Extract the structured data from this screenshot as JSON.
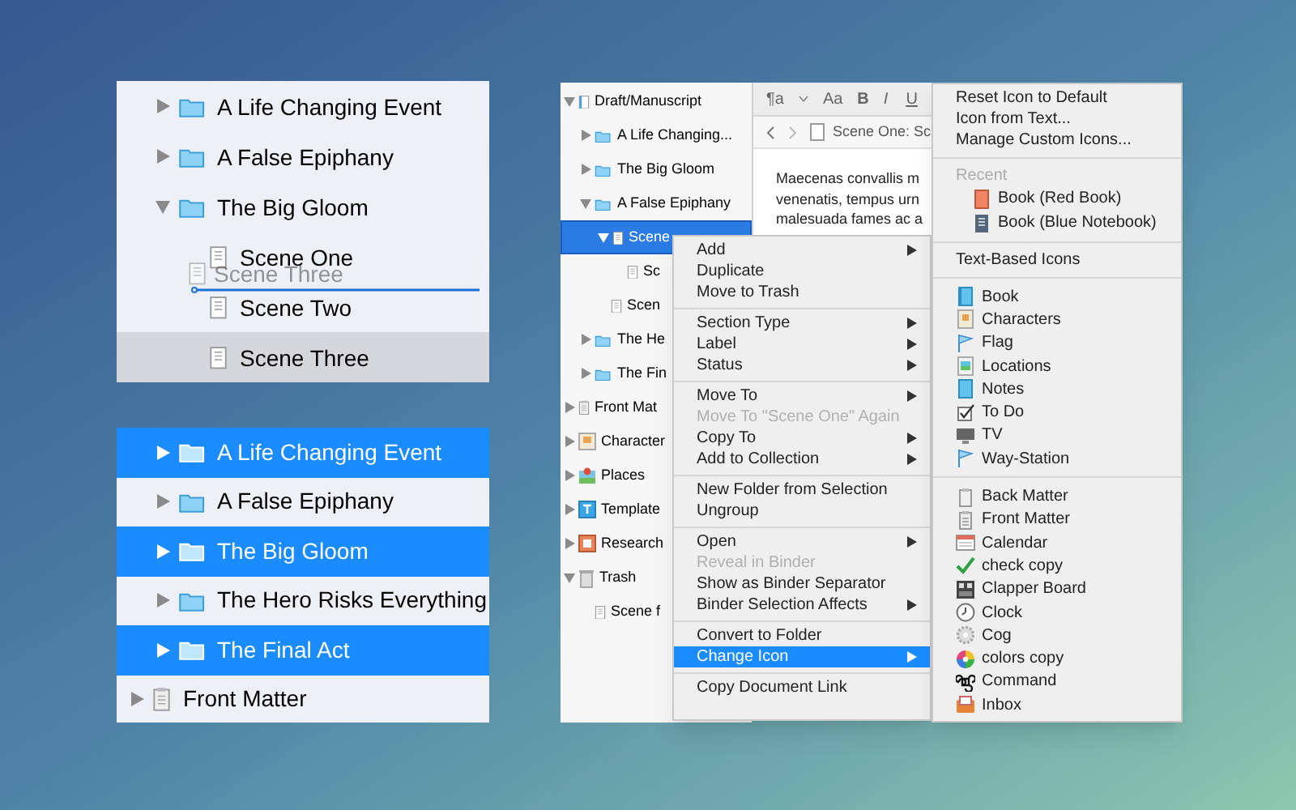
{
  "outline_panel": {
    "items": [
      {
        "label": "A Life Changing Event",
        "kind": "folder",
        "expanded": false,
        "selected": false
      },
      {
        "label": "A False Epiphany",
        "kind": "folder",
        "expanded": false,
        "selected": false
      },
      {
        "label": "The Big Gloom",
        "kind": "folder",
        "expanded": true,
        "selected": false,
        "children": [
          {
            "label": "Scene One",
            "kind": "document",
            "selected": false
          },
          {
            "label": "Scene Two",
            "kind": "document",
            "selected": false
          },
          {
            "label": "Scene Three",
            "kind": "document",
            "selected": true
          }
        ]
      }
    ],
    "drag_ghost": {
      "label": "Scene Three"
    }
  },
  "selection_panel": {
    "items": [
      {
        "label": "A Life Changing Event",
        "kind": "folder",
        "selected": true
      },
      {
        "label": "A False Epiphany",
        "kind": "folder",
        "selected": false
      },
      {
        "label": "The Big Gloom",
        "kind": "folder",
        "selected": true
      },
      {
        "label": "The Hero Risks Everything",
        "kind": "folder",
        "selected": false
      },
      {
        "label": "The Final Act",
        "kind": "folder",
        "selected": true
      },
      {
        "label": "Front Matter",
        "kind": "front-matter",
        "selected": false
      }
    ]
  },
  "binder": {
    "items": [
      {
        "label": "Draft/Manuscript",
        "kind": "draft",
        "expanded": true,
        "selected": false,
        "children": [
          {
            "label": "A Life Changing...",
            "kind": "folder",
            "expanded": false,
            "selected": false
          },
          {
            "label": "The Big Gloom",
            "kind": "folder",
            "expanded": false,
            "selected": false
          },
          {
            "label": "A False Epiphany",
            "kind": "folder",
            "expanded": true,
            "selected": false,
            "children": [
              {
                "label": "Scene",
                "kind": "document",
                "expanded": true,
                "selected": true,
                "children": [
                  {
                    "label": "Sc",
                    "kind": "document",
                    "selected": false
                  }
                ]
              },
              {
                "label": "Scen",
                "kind": "document",
                "selected": false
              }
            ]
          },
          {
            "label": "The He",
            "kind": "folder",
            "expanded": false,
            "selected": false
          },
          {
            "label": "The Fin",
            "kind": "folder",
            "expanded": false,
            "selected": false
          }
        ]
      },
      {
        "label": "Front Mat",
        "kind": "front-matter",
        "expanded": false,
        "selected": false
      },
      {
        "label": "Character",
        "kind": "characters",
        "expanded": false,
        "selected": false
      },
      {
        "label": "Places",
        "kind": "places",
        "expanded": false,
        "selected": false
      },
      {
        "label": "Template",
        "kind": "template",
        "expanded": false,
        "selected": false
      },
      {
        "label": "Research",
        "kind": "research",
        "expanded": false,
        "selected": false
      },
      {
        "label": "Trash",
        "kind": "trash",
        "expanded": true,
        "selected": false,
        "children": [
          {
            "label": "Scene f",
            "kind": "document",
            "selected": false
          }
        ]
      }
    ]
  },
  "editor": {
    "toolbar": [
      "¶a",
      "Aa",
      "B",
      "I",
      "U"
    ],
    "header_title": "Scene One: Sc",
    "text_lines": [
      "Maecenas convallis m",
      "venenatis, tempus urn",
      "malesuada fames ac a"
    ]
  },
  "context_menu": {
    "sections": [
      [
        {
          "label": "Add",
          "has_submenu": true,
          "disabled": false,
          "selected": false
        },
        {
          "label": "Duplicate",
          "has_submenu": false,
          "disabled": false,
          "selected": false
        },
        {
          "label": "Move to Trash",
          "has_submenu": false,
          "disabled": false,
          "selected": false
        }
      ],
      [
        {
          "label": "Section Type",
          "has_submenu": true,
          "disabled": false,
          "selected": false
        },
        {
          "label": "Label",
          "has_submenu": true,
          "disabled": false,
          "selected": false
        },
        {
          "label": "Status",
          "has_submenu": true,
          "disabled": false,
          "selected": false
        }
      ],
      [
        {
          "label": "Move To",
          "has_submenu": true,
          "disabled": false,
          "selected": false
        },
        {
          "label": "Move To \"Scene One\" Again",
          "has_submenu": false,
          "disabled": true,
          "selected": false
        },
        {
          "label": "Copy To",
          "has_submenu": true,
          "disabled": false,
          "selected": false
        },
        {
          "label": "Add to Collection",
          "has_submenu": true,
          "disabled": false,
          "selected": false
        }
      ],
      [
        {
          "label": "New Folder from Selection",
          "has_submenu": false,
          "disabled": false,
          "selected": false
        },
        {
          "label": "Ungroup",
          "has_submenu": false,
          "disabled": false,
          "selected": false
        }
      ],
      [
        {
          "label": "Open",
          "has_submenu": true,
          "disabled": false,
          "selected": false
        },
        {
          "label": "Reveal in Binder",
          "has_submenu": false,
          "disabled": true,
          "selected": false
        },
        {
          "label": "Show as Binder Separator",
          "has_submenu": false,
          "disabled": false,
          "selected": false
        },
        {
          "label": "Binder Selection Affects",
          "has_submenu": true,
          "disabled": false,
          "selected": false
        }
      ],
      [
        {
          "label": "Convert to Folder",
          "has_submenu": false,
          "disabled": false,
          "selected": false
        },
        {
          "label": "Change Icon",
          "has_submenu": true,
          "disabled": false,
          "selected": true
        }
      ],
      [
        {
          "label": "Copy Document Link",
          "has_submenu": false,
          "disabled": false,
          "selected": false
        }
      ]
    ]
  },
  "icon_menu": {
    "sections": [
      [
        {
          "label": "Reset Icon to Default",
          "kind": "command"
        },
        {
          "label": "Icon from Text...",
          "kind": "command"
        },
        {
          "label": "Manage Custom Icons...",
          "kind": "command"
        }
      ],
      [
        {
          "label": "Recent",
          "kind": "header"
        },
        {
          "label": "Book (Red Book)",
          "kind": "recent"
        },
        {
          "label": "Book (Blue Notebook)",
          "kind": "recent"
        }
      ],
      [
        {
          "label": "Text-Based Icons",
          "kind": "command"
        }
      ],
      [
        {
          "label": "Book",
          "kind": "icon"
        },
        {
          "label": "Characters",
          "kind": "icon"
        },
        {
          "label": "Flag",
          "kind": "icon"
        },
        {
          "label": "Locations",
          "kind": "icon"
        },
        {
          "label": "Notes",
          "kind": "icon"
        },
        {
          "label": "To Do",
          "kind": "icon"
        },
        {
          "label": "TV",
          "kind": "icon"
        },
        {
          "label": "Way-Station",
          "kind": "icon"
        }
      ],
      [
        {
          "label": "Back Matter",
          "kind": "icon"
        },
        {
          "label": "Front Matter",
          "kind": "icon"
        },
        {
          "label": "Calendar",
          "kind": "icon"
        },
        {
          "label": "check copy",
          "kind": "icon"
        },
        {
          "label": "Clapper Board",
          "kind": "icon"
        },
        {
          "label": "Clock",
          "kind": "icon"
        },
        {
          "label": "Cog",
          "kind": "icon"
        },
        {
          "label": "colors copy",
          "kind": "icon"
        },
        {
          "label": "Command",
          "kind": "icon"
        },
        {
          "label": "Inbox",
          "kind": "icon"
        }
      ]
    ]
  }
}
